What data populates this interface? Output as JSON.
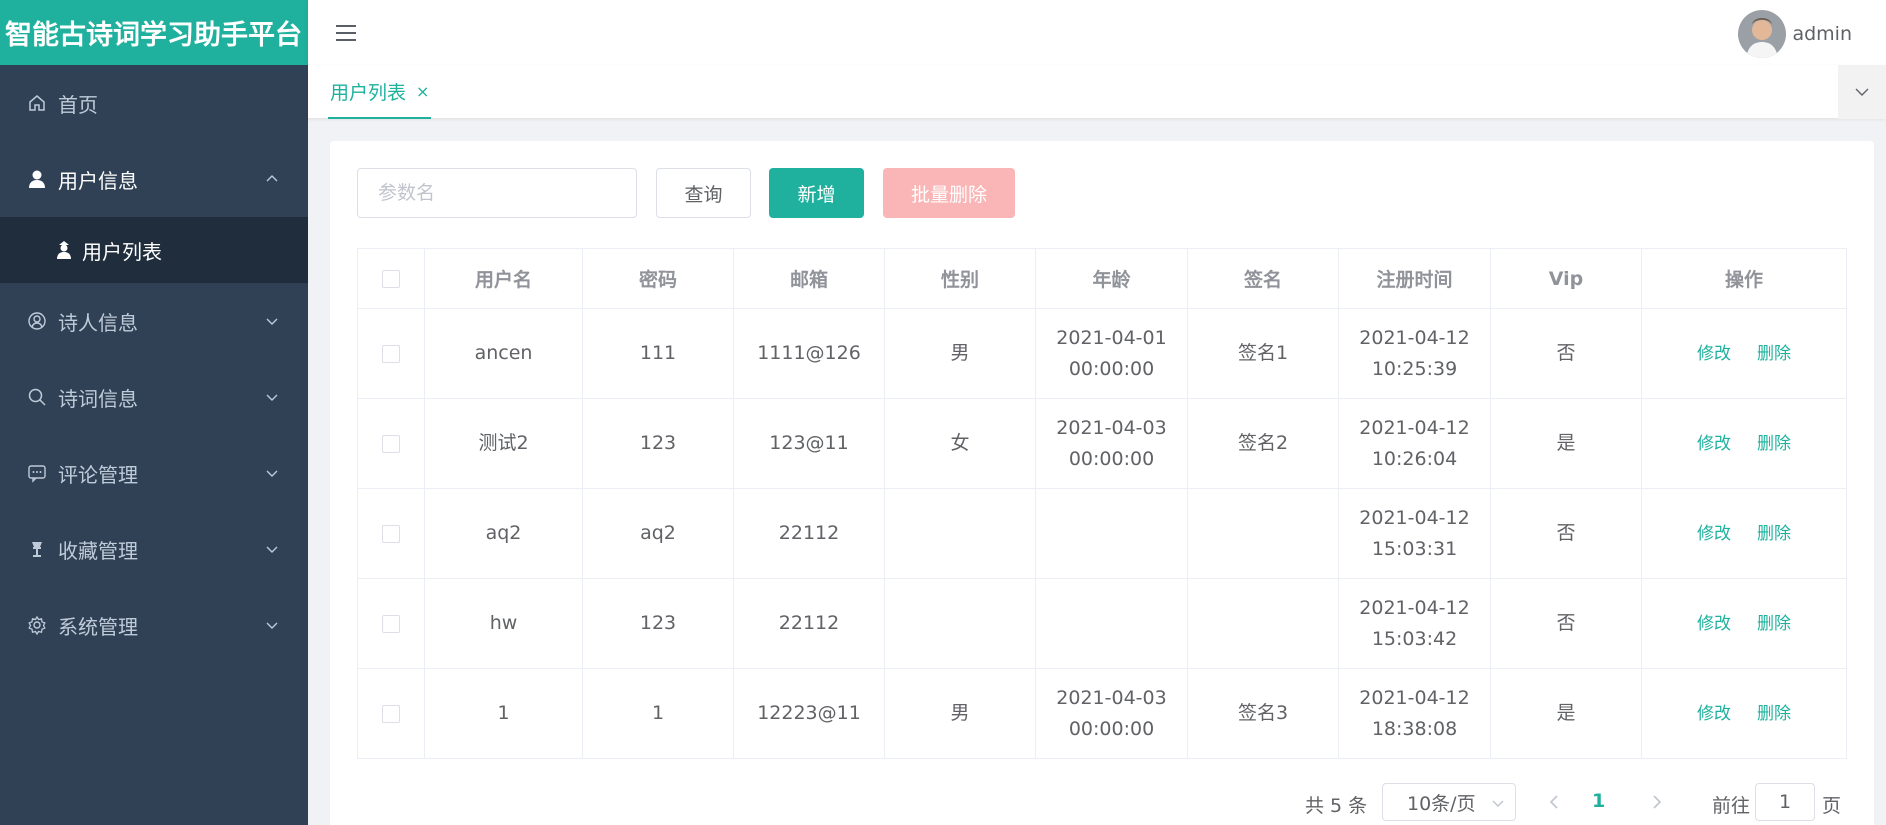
{
  "app": {
    "title": "智能古诗词学习助手平台"
  },
  "sidebar": {
    "items": [
      {
        "label": "首页",
        "icon": "home-icon"
      },
      {
        "label": "用户信息",
        "icon": "user-icon",
        "expanded": true,
        "children": [
          {
            "label": "用户列表",
            "icon": "user-list-icon"
          }
        ]
      },
      {
        "label": "诗人信息",
        "icon": "user-circle-icon"
      },
      {
        "label": "诗词信息",
        "icon": "search-icon"
      },
      {
        "label": "评论管理",
        "icon": "comment-icon"
      },
      {
        "label": "收藏管理",
        "icon": "collection-icon"
      },
      {
        "label": "系统管理",
        "icon": "gear-icon"
      }
    ]
  },
  "header": {
    "username": "admin",
    "menu_icon": "hamburger-icon"
  },
  "tags": {
    "active": "用户列表",
    "close": "×"
  },
  "toolbar": {
    "search_placeholder": "参数名",
    "query_label": "查询",
    "add_label": "新增",
    "batch_delete_label": "批量删除"
  },
  "table": {
    "headers": [
      "用户名",
      "密码",
      "邮箱",
      "性别",
      "年龄",
      "签名",
      "注册时间",
      "Vip",
      "操作"
    ],
    "rows": [
      {
        "username": "ancen",
        "password": "111",
        "email": "1111@126",
        "gender": "男",
        "age": "2021-04-01 00:00:00",
        "signature": "签名1",
        "reg_time": "2021-04-12 10:25:39",
        "vip": "否"
      },
      {
        "username": "测试2",
        "password": "123",
        "email": "123@11",
        "gender": "女",
        "age": "2021-04-03 00:00:00",
        "signature": "签名2",
        "reg_time": "2021-04-12 10:26:04",
        "vip": "是"
      },
      {
        "username": "aq2",
        "password": "aq2",
        "email": "22112",
        "gender": "",
        "age": "",
        "signature": "",
        "reg_time": "2021-04-12 15:03:31",
        "vip": "否"
      },
      {
        "username": "hw",
        "password": "123",
        "email": "22112",
        "gender": "",
        "age": "",
        "signature": "",
        "reg_time": "2021-04-12 15:03:42",
        "vip": "否"
      },
      {
        "username": "1",
        "password": "1",
        "email": "12223@11",
        "gender": "男",
        "age": "2021-04-03 00:00:00",
        "signature": "签名3",
        "reg_time": "2021-04-12 18:38:08",
        "vip": "是"
      }
    ],
    "edit_label": "修改",
    "delete_label": "删除"
  },
  "pagination": {
    "total_text": "共 5 条",
    "page_size": "10条/页",
    "current_page": "1",
    "goto_label": "前往",
    "goto_value": "1",
    "page_suffix": "页"
  },
  "colors": {
    "primary": "#1fb19e",
    "sidebar_bg": "#304156",
    "submenu_bg": "#1f2d3d",
    "danger_light": "#fab6b6"
  }
}
